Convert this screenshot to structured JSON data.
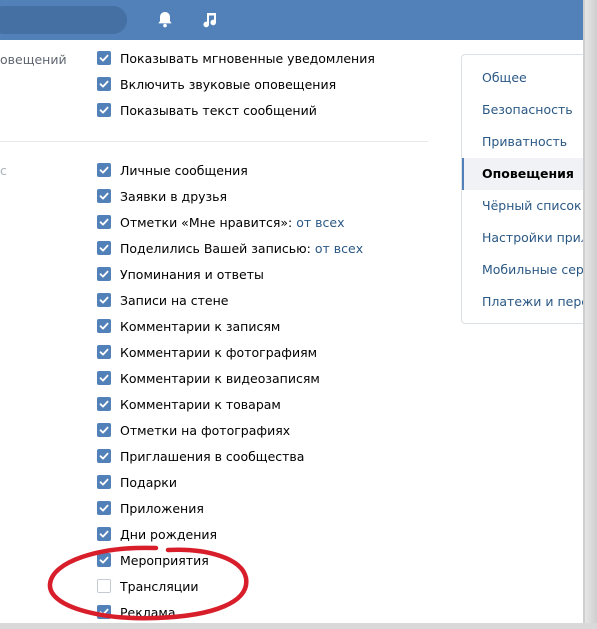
{
  "left": {
    "section1_label": "овещений",
    "section2_label": "с"
  },
  "options": [
    {
      "label": "Показывать мгновенные уведомления",
      "checked": true
    },
    {
      "label": "Включить звуковые оповещения",
      "checked": true
    },
    {
      "label": "Показывать текст сообщений",
      "checked": true
    },
    {
      "label": "Личные сообщения",
      "checked": true
    },
    {
      "label": "Заявки в друзья",
      "checked": true
    },
    {
      "label": "Отметки «Мне нравится»:",
      "checked": true,
      "link": "от всех"
    },
    {
      "label": "Поделились Вашей записью:",
      "checked": true,
      "link": "от всех"
    },
    {
      "label": "Упоминания и ответы",
      "checked": true
    },
    {
      "label": "Записи на стене",
      "checked": true
    },
    {
      "label": "Комментарии к записям",
      "checked": true
    },
    {
      "label": "Комментарии к фотографиям",
      "checked": true
    },
    {
      "label": "Комментарии к видеозаписям",
      "checked": true
    },
    {
      "label": "Комментарии к товарам",
      "checked": true
    },
    {
      "label": "Отметки на фотографиях",
      "checked": true
    },
    {
      "label": "Приглашения в сообщества",
      "checked": true
    },
    {
      "label": "Подарки",
      "checked": true
    },
    {
      "label": "Приложения",
      "checked": true
    },
    {
      "label": "Дни рождения",
      "checked": true
    },
    {
      "label": "Мероприятия",
      "checked": true
    },
    {
      "label": "Трансляции",
      "checked": false
    },
    {
      "label": "Реклама",
      "checked": true
    }
  ],
  "menu": [
    {
      "label": "Общее"
    },
    {
      "label": "Безопасность"
    },
    {
      "label": "Приватность"
    },
    {
      "label": "Оповещения",
      "active": true
    },
    {
      "label": "Чёрный список"
    },
    {
      "label": "Настройки прилож"
    },
    {
      "label": "Мобильные серви"
    },
    {
      "label": "Платежи и перево"
    }
  ],
  "colors": {
    "header": "#5181b8",
    "checkbox": "#5181b8",
    "link": "#2a5885",
    "marker": "#d81e2b"
  },
  "icons": [
    "bell-icon",
    "music-icon",
    "check-icon"
  ]
}
